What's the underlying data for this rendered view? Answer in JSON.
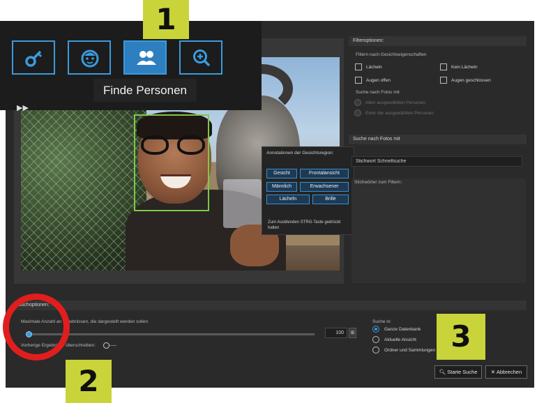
{
  "toolbar": {
    "tools": [
      {
        "icon": "key-icon"
      },
      {
        "icon": "face-icon"
      },
      {
        "icon": "people-icon",
        "active": true
      },
      {
        "icon": "zoom-in-icon"
      }
    ],
    "tooltip": "Finde Personen"
  },
  "callouts": {
    "one": "1",
    "two": "2",
    "three": "3"
  },
  "annotations": {
    "title": "Annotationen der Gesichtsregion:",
    "tags": [
      "Gesicht",
      "Frontalansicht",
      "Männlich",
      "Erwachsener",
      "Lächeln",
      "Brille"
    ],
    "hint": "Zum Ausblenden STRG-Taste gedrückt halten"
  },
  "filter": {
    "header": "Filteroptionen:",
    "by_face_props": "Filtern nach Gesichtseigenschaften",
    "checkboxes": [
      "Lächeln",
      "Kein Lächeln",
      "Augen offen",
      "Augen geschlossen"
    ],
    "search_photos_label": "Suche nach Fotos mit",
    "radios": [
      "Allen ausgewählten Personen",
      "Einer der ausgewählten Personen"
    ]
  },
  "keyword": {
    "header": "Suche nach Fotos mit",
    "input_value": "Stichwort Schnellsuche",
    "keywords_label": "Stichwörter zum Filtern:"
  },
  "options": {
    "header": "Suchoptionen:",
    "max_label": "Maximale Anzahl an Ergebnissen, die dargestellt werden sollen",
    "max_value": "100",
    "spin_glyph": "⊞",
    "prev_label": "Vorherige Ergebnisse überschreiben:",
    "search_in_label": "Suche in:",
    "search_in": [
      "Ganze Datenbank",
      "Aktuelle Ansicht",
      "Ordner und Sammlungen"
    ],
    "selected_index": 0
  },
  "buttons": {
    "start": "Starte Suche",
    "cancel": "Abbrechen",
    "start_icon": "search-icon",
    "cancel_icon": "close-icon"
  },
  "colors": {
    "accent": "#3a9bde",
    "callout": "#c8d43a",
    "highlight_circle": "#e01e1e",
    "face_box": "#7ec84a"
  }
}
